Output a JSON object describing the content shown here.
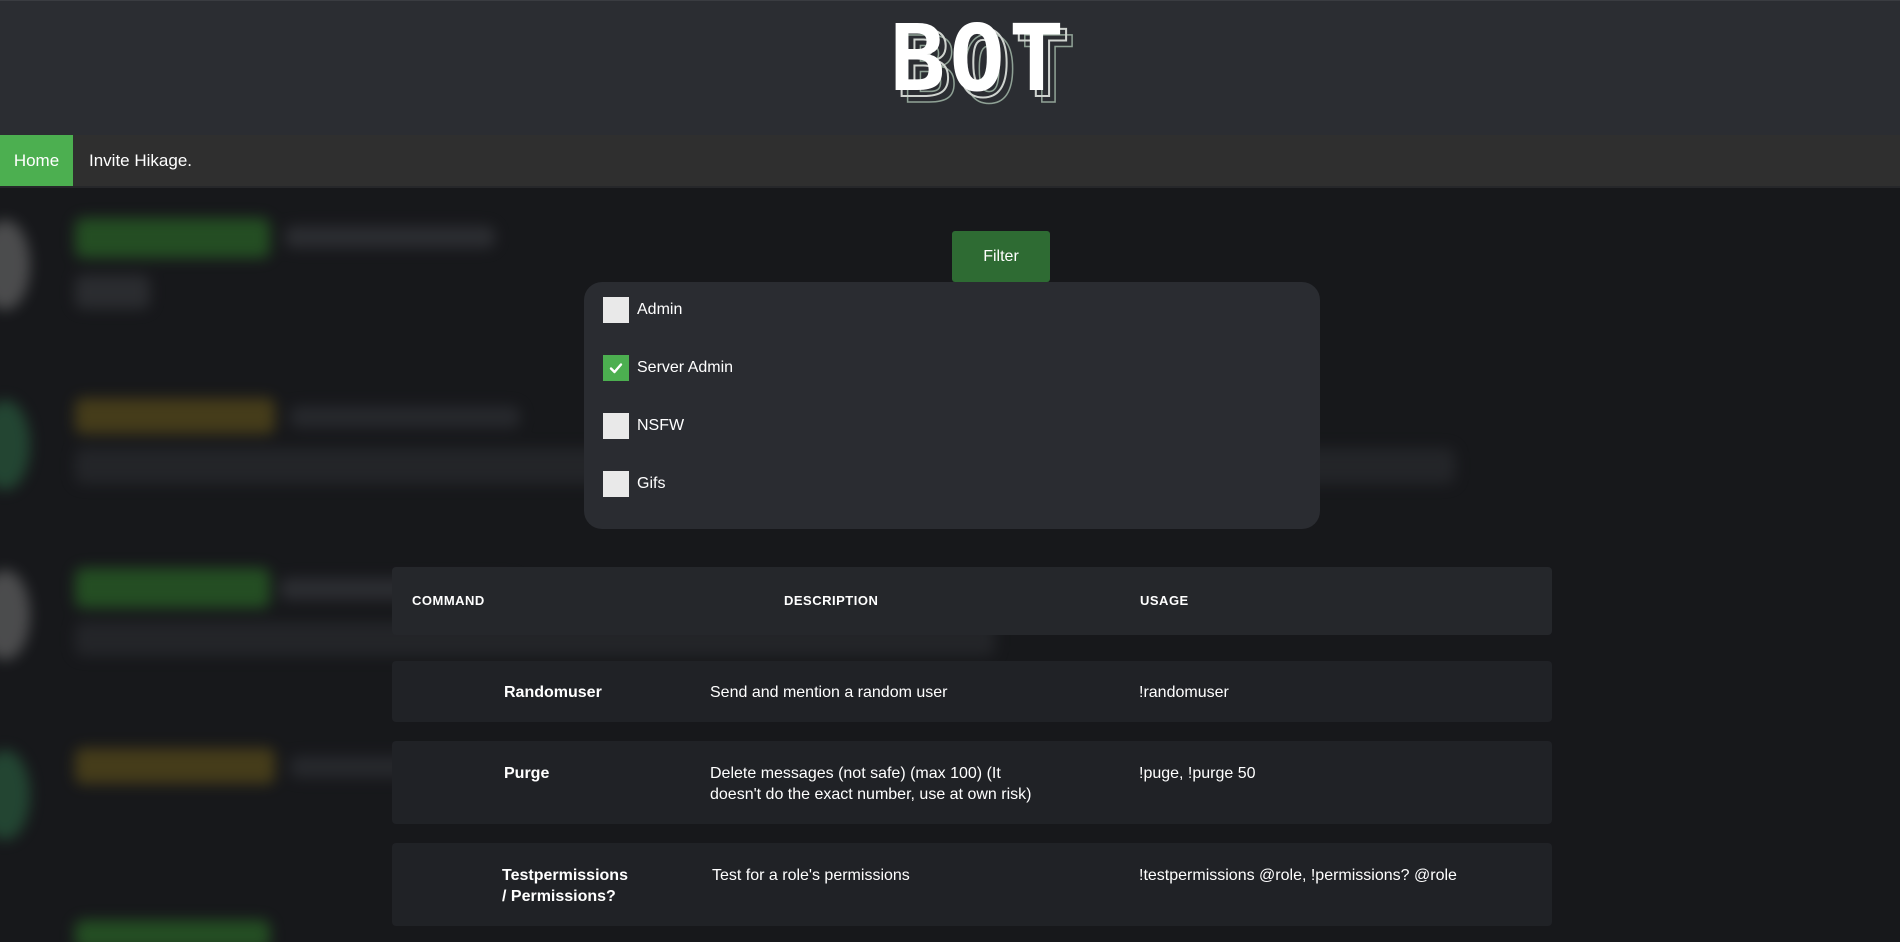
{
  "header": {
    "logo_text": "BOT"
  },
  "nav": {
    "items": [
      {
        "label": "Home"
      },
      {
        "label": "Invite Hikage."
      }
    ]
  },
  "filter": {
    "button_label": "Filter",
    "options": [
      {
        "label": "Admin",
        "checked": false
      },
      {
        "label": "Server Admin",
        "checked": true
      },
      {
        "label": "NSFW",
        "checked": false
      },
      {
        "label": "Gifs",
        "checked": false
      }
    ]
  },
  "table": {
    "headers": [
      "COMMAND",
      "DESCRIPTION",
      "USAGE"
    ],
    "rows": [
      {
        "command": "Randomuser",
        "description": "Send and mention a random user",
        "usage": "!randomuser"
      },
      {
        "command": "Purge",
        "description": "Delete messages (not safe) (max 100) (It doesn't do the exact number, use at own risk)",
        "usage": "!puge, !purge 50"
      },
      {
        "command": "Testpermissions / Permissions?",
        "description": "Test for a role's permissions",
        "usage": "!testpermissions @role, !permissions? @role"
      }
    ]
  },
  "colors": {
    "accent": "#4caf50",
    "filter_button": "#2e6b33",
    "header": "#2b2d32",
    "nav": "#2f2f2f",
    "background": "#17181b"
  }
}
